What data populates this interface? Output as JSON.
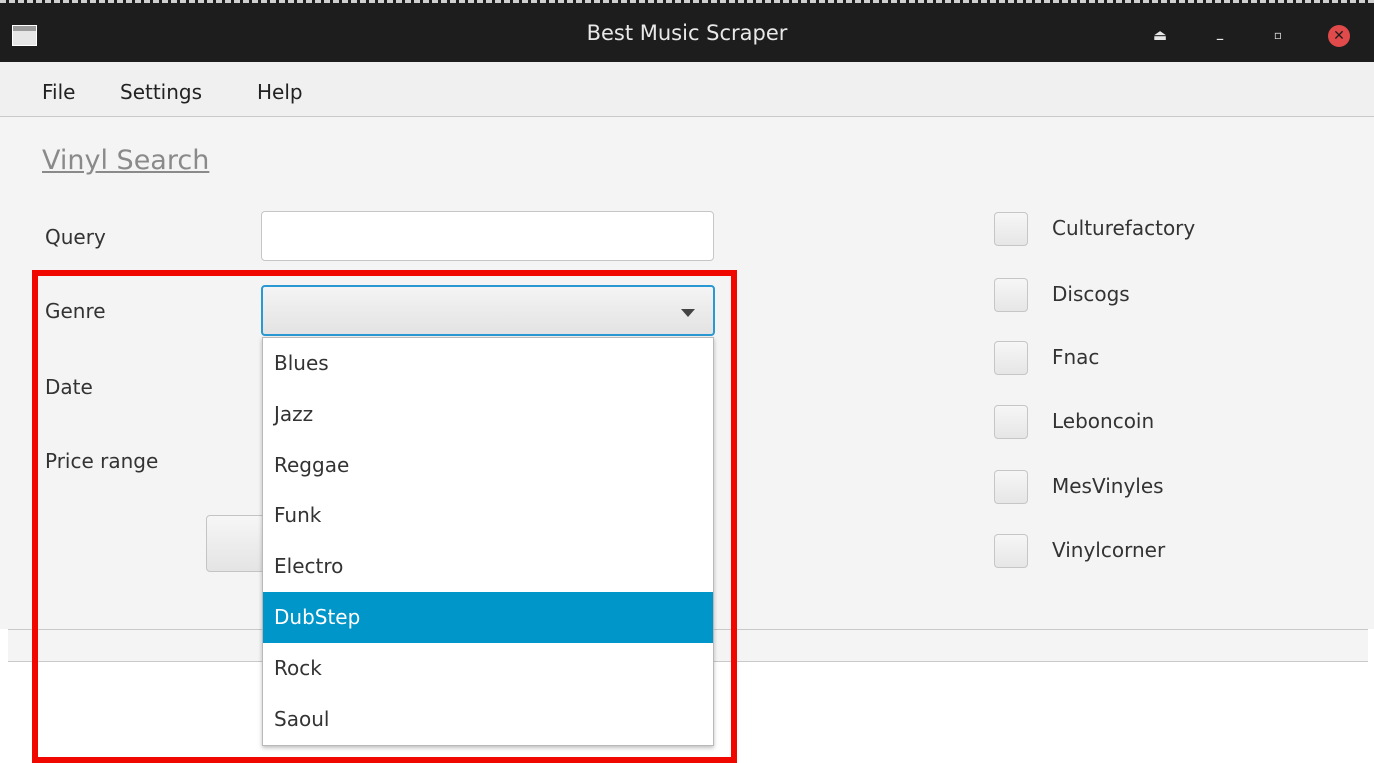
{
  "window": {
    "title": "Best Music Scraper",
    "controls": {
      "eject": "⏏",
      "minimize": "–",
      "restore": "▫",
      "close": "✕"
    }
  },
  "menu": {
    "items": [
      "File",
      "Settings",
      "Help"
    ]
  },
  "form": {
    "heading": "Vinyl Search",
    "labels": {
      "query": "Query",
      "genre": "Genre",
      "date": "Date",
      "price": "Price range"
    },
    "query_value": "",
    "genre_value": ""
  },
  "genre_options": [
    "Blues",
    "Jazz",
    "Reggae",
    "Funk",
    "Electro",
    "DubStep",
    "Rock",
    "Saoul"
  ],
  "genre_highlighted": "DubStep",
  "sources": [
    "Culturefactory",
    "Discogs",
    "Fnac",
    "Leboncoin",
    "MesVinyles",
    "Vinylcorner"
  ],
  "colors": {
    "accent": "#0096c9",
    "annotation": "#f00800",
    "focus": "#2a98d2"
  }
}
